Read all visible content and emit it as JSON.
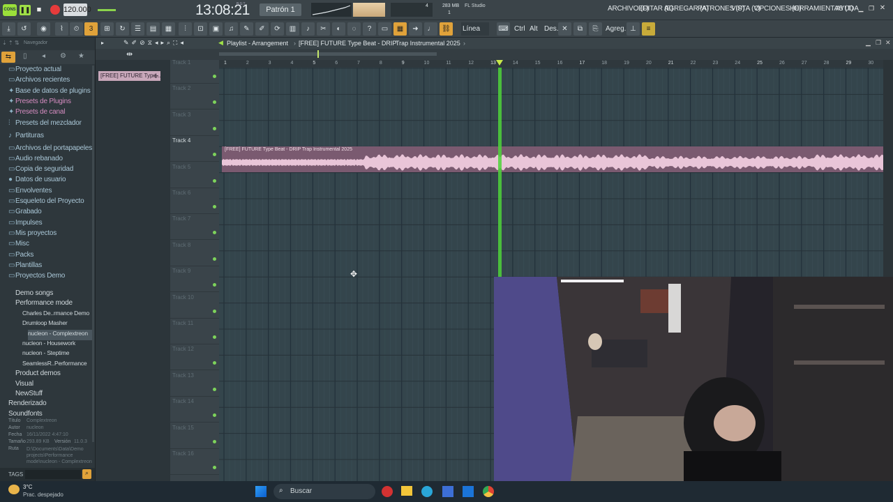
{
  "top": {
    "tempo": "120.000",
    "time": "13:08:21",
    "time_sub": "B:S:T",
    "pattern": "Patrón 1",
    "cpu_value": "4",
    "ram": "283 MB",
    "ram_sub": "1",
    "app_name": "FL Studio",
    "menu": [
      "ARCHIVO (F)",
      "EDITAR (E)",
      "AGREGAR (A)",
      "PATRONES (P)",
      "VISTA (V)",
      "OPCIONES (O)",
      "HERRAMIENTAS (T)",
      "AYUDA"
    ]
  },
  "toolbar": {
    "snap_label": "Línea",
    "labels": [
      "Ctrl",
      "Alt",
      "Des.",
      "Agreg."
    ]
  },
  "browser": {
    "header": "Navegador",
    "items": [
      {
        "label": "Proyecto actual",
        "icon": "folder-icon"
      },
      {
        "label": "Archivos recientes",
        "icon": "folder-icon"
      },
      {
        "label": "Base de datos de plugins",
        "icon": "plug-icon"
      },
      {
        "label": "Presets de Plugins",
        "icon": "plug-icon"
      },
      {
        "label": "Presets de canal",
        "icon": "plug-icon"
      },
      {
        "label": "Presets del mezclador",
        "icon": "mixer-icon"
      },
      {
        "label": "Partituras",
        "icon": "note-icon"
      },
      {
        "label": "Archivos del portapapeles",
        "icon": "folder-icon"
      },
      {
        "label": "Audio rebanado",
        "icon": "folder-icon"
      },
      {
        "label": "Copia de seguridad",
        "icon": "folder-icon"
      },
      {
        "label": "Datos de usuario",
        "icon": "user-icon"
      },
      {
        "label": "Envolventes",
        "icon": "folder-icon"
      },
      {
        "label": "Esqueleto del Proyecto",
        "icon": "folder-icon"
      },
      {
        "label": "Grabado",
        "icon": "folder-icon"
      },
      {
        "label": "Impulses",
        "icon": "folder-icon"
      },
      {
        "label": "Mis proyectos",
        "icon": "folder-icon"
      },
      {
        "label": "Misc",
        "icon": "folder-icon"
      },
      {
        "label": "Packs",
        "icon": "folder-icon"
      },
      {
        "label": "Plantillas",
        "icon": "folder-icon"
      },
      {
        "label": "Proyectos Demo",
        "icon": "folder-icon"
      }
    ],
    "subitems": [
      {
        "label": "Demo songs",
        "indent": 1
      },
      {
        "label": "Performance mode",
        "indent": 1
      },
      {
        "label": "Charles De..rmance Demo",
        "indent": 2
      },
      {
        "label": "Drumloop Masher",
        "indent": 2
      },
      {
        "label": "nucleon - Complextreon",
        "indent": 2
      },
      {
        "label": "nucleon - Housework",
        "indent": 2
      },
      {
        "label": "nucleon - Steptime",
        "indent": 2
      },
      {
        "label": "SeamlessR..Performance",
        "indent": 2
      },
      {
        "label": "Product demos",
        "indent": 1
      },
      {
        "label": "Visual",
        "indent": 1
      },
      {
        "label": "NewStuff",
        "indent": 1
      },
      {
        "label": "Renderizado",
        "indent": 0
      },
      {
        "label": "Soundfonts",
        "indent": 0
      }
    ],
    "info": {
      "title_label": "Título",
      "title": "Complextreon",
      "author_label": "Autor",
      "author": "nucleon",
      "date_label": "Fecha",
      "date": "16/11/2022 4:47:10",
      "size_label": "Tamaño",
      "size": "293.89 KB",
      "version_label": "Versión",
      "version": "11.0.3",
      "path_label": "Ruta",
      "path": "D:\\Documents\\Data\\Demo projects\\Performance mode\\nucleon - Complextreon"
    },
    "tags_label": "TAGS"
  },
  "playlist": {
    "breadcrumb": [
      "Playlist - Arrangement",
      "[FREE] FUTURE Type Beat - DRIP",
      "Trap Instrumental 2025"
    ],
    "pattern_clip": "[FREE] FUTURE Type...",
    "clip_title": "[FREE] FUTURE Type Beat - DRIP   Trap Instrumental 2025",
    "tracks": [
      "Track 1",
      "Track 2",
      "Track 3",
      "Track 4",
      "Track 5",
      "Track 6",
      "Track 7",
      "Track 8",
      "Track 9",
      "Track 10",
      "Track 11",
      "Track 12",
      "Track 13",
      "Track 14",
      "Track 15",
      "Track 16"
    ],
    "bars": [
      "1",
      "2",
      "3",
      "4",
      "5",
      "6",
      "7",
      "8",
      "9",
      "10",
      "11",
      "12",
      "13",
      "14",
      "15",
      "16",
      "17",
      "18",
      "19",
      "20",
      "21",
      "22",
      "23",
      "24",
      "25",
      "26",
      "27",
      "28",
      "29",
      "30"
    ],
    "playhead_bar": 13.4
  },
  "taskbar": {
    "temp": "3°C",
    "weather": "Prac. despejado",
    "search": "Buscar"
  },
  "colors": {
    "playhead": "#4fd43a",
    "clip": "#7a5a70",
    "wave": "#e9c5d8",
    "grid": "#34454c"
  }
}
